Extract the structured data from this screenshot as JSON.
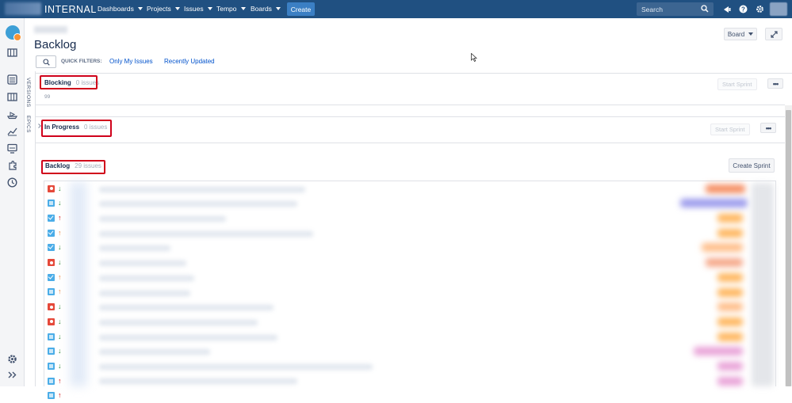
{
  "header": {
    "brand": "INTERNAL",
    "nav": [
      {
        "label": "Dashboards"
      },
      {
        "label": "Projects"
      },
      {
        "label": "Issues"
      },
      {
        "label": "Tempo"
      },
      {
        "label": "Boards"
      }
    ],
    "create_label": "Create",
    "search_placeholder": "Search"
  },
  "sidebar": {
    "icons": [
      "backlog-icon",
      "board-icon",
      "releases-icon",
      "components-icon",
      "reports-icon",
      "dashboard-icon",
      "addons-icon",
      "clock-icon",
      "settings-icon",
      "expand-sidebar-icon"
    ]
  },
  "page": {
    "title": "Backlog",
    "board_button": "Board",
    "quick_filters_label": "QUICK FILTERS:",
    "quick_filters": [
      "Only My Issues",
      "Recently Updated"
    ],
    "vertical_tabs": [
      "VERSIONS",
      "EPICS"
    ]
  },
  "sprints": [
    {
      "name": "Blocking",
      "count": "0 issues",
      "sub": "99",
      "action": "Start Sprint"
    },
    {
      "name": "In Progress",
      "count": "0 issues",
      "action": "Start Sprint"
    },
    {
      "name": "Backlog",
      "count": "29 issues",
      "action": "Create Sprint"
    }
  ],
  "more_label": "•••",
  "issues": [
    {
      "type": "bug",
      "priority": "low"
    },
    {
      "type": "story",
      "priority": "low"
    },
    {
      "type": "task",
      "priority": "highest"
    },
    {
      "type": "task",
      "priority": "medium"
    },
    {
      "type": "task",
      "priority": "low"
    },
    {
      "type": "bug",
      "priority": "low"
    },
    {
      "type": "task",
      "priority": "medium"
    },
    {
      "type": "story",
      "priority": "medium"
    },
    {
      "type": "bug",
      "priority": "low"
    },
    {
      "type": "bug",
      "priority": "low"
    },
    {
      "type": "story",
      "priority": "low"
    },
    {
      "type": "story",
      "priority": "low"
    },
    {
      "type": "story",
      "priority": "low"
    },
    {
      "type": "story",
      "priority": "highest"
    },
    {
      "type": "story",
      "priority": "highest"
    }
  ],
  "colors": {
    "topbar": "#205081",
    "highlight": "#d0021b",
    "link": "#0052cc",
    "priority_low": "#2a8735",
    "priority_medium": "#e97f33",
    "priority_highest": "#ce0000"
  }
}
